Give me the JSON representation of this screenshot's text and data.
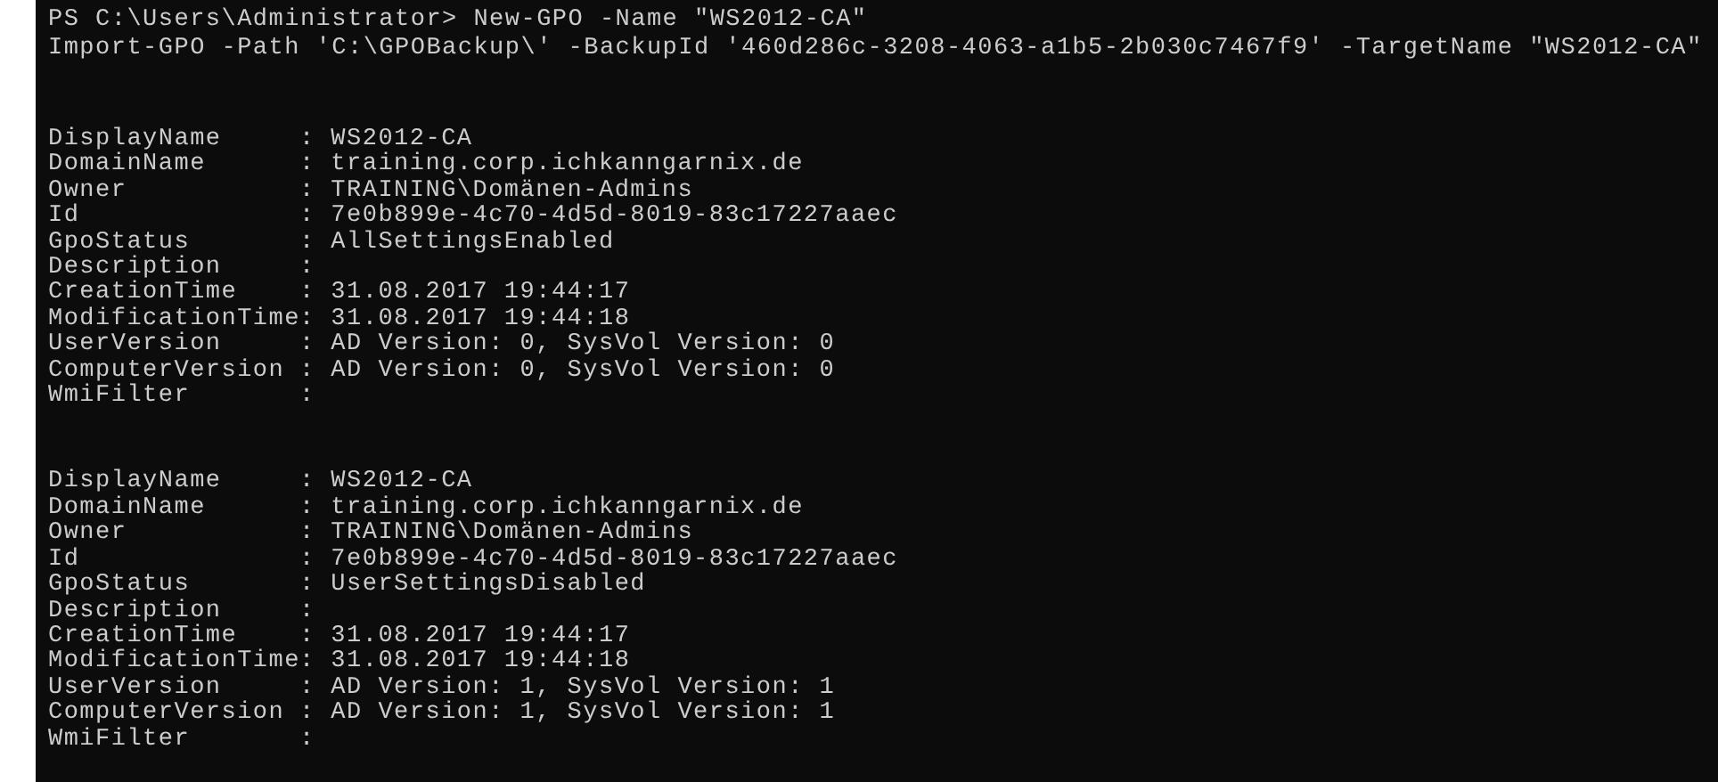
{
  "console": {
    "commands": [
      "PS C:\\Users\\Administrator> New-GPO -Name \"WS2012-CA\"",
      "Import-GPO -Path 'C:\\GPOBackup\\' -BackupId '460d286c-3208-4063-a1b5-2b030c7467f9' -TargetName \"WS2012-CA\""
    ],
    "records": [
      {
        "fields": [
          {
            "name": "DisplayName",
            "value": ": WS2012-CA"
          },
          {
            "name": "DomainName",
            "value": ": training.corp.ichkanngarnix.de"
          },
          {
            "name": "Owner",
            "value": ": TRAINING\\Domänen-Admins"
          },
          {
            "name": "Id",
            "value": ": 7e0b899e-4c70-4d5d-8019-83c17227aaec"
          },
          {
            "name": "GpoStatus",
            "value": ": AllSettingsEnabled"
          },
          {
            "name": "Description",
            "value": ":"
          },
          {
            "name": "CreationTime",
            "value": ": 31.08.2017 19:44:17"
          },
          {
            "name": "ModificationTime",
            "value": ": 31.08.2017 19:44:18"
          },
          {
            "name": "UserVersion",
            "value": ": AD Version: 0, SysVol Version: 0"
          },
          {
            "name": "ComputerVersion",
            "value": ": AD Version: 0, SysVol Version: 0"
          },
          {
            "name": "WmiFilter",
            "value": ":"
          }
        ]
      },
      {
        "fields": [
          {
            "name": "DisplayName",
            "value": ": WS2012-CA"
          },
          {
            "name": "DomainName",
            "value": ": training.corp.ichkanngarnix.de"
          },
          {
            "name": "Owner",
            "value": ": TRAINING\\Domänen-Admins"
          },
          {
            "name": "Id",
            "value": ": 7e0b899e-4c70-4d5d-8019-83c17227aaec"
          },
          {
            "name": "GpoStatus",
            "value": ": UserSettingsDisabled"
          },
          {
            "name": "Description",
            "value": ":"
          },
          {
            "name": "CreationTime",
            "value": ": 31.08.2017 19:44:17"
          },
          {
            "name": "ModificationTime",
            "value": ": 31.08.2017 19:44:18"
          },
          {
            "name": "UserVersion",
            "value": ": AD Version: 1, SysVol Version: 1"
          },
          {
            "name": "ComputerVersion",
            "value": ": AD Version: 1, SysVol Version: 1"
          },
          {
            "name": "WmiFilter",
            "value": ":"
          }
        ]
      }
    ]
  }
}
